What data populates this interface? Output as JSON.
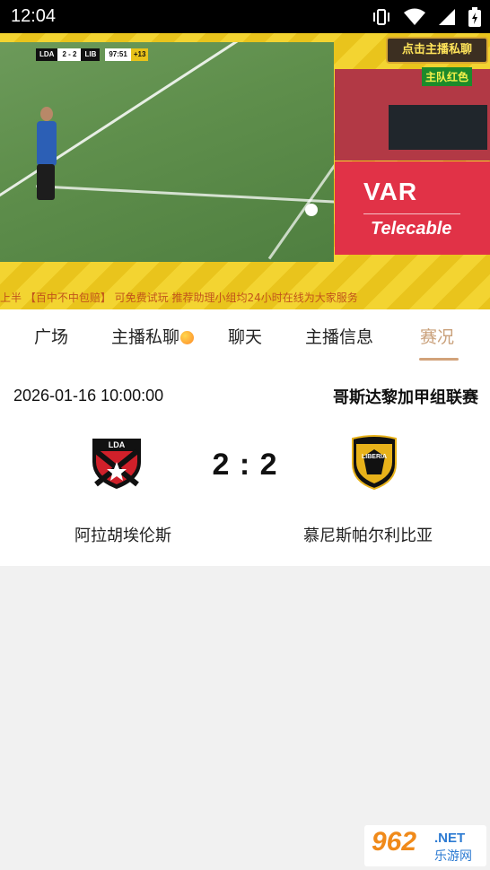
{
  "status_bar": {
    "time": "12:04",
    "icons": [
      "vibrate-icon",
      "wifi-icon",
      "signal-icon",
      "battery-icon"
    ]
  },
  "video": {
    "scorebug": {
      "home": "LDA",
      "score": "2 - 2",
      "away": "LIB",
      "clock": "97:51",
      "added": "+13"
    },
    "brand_badge": "点击主播私聊",
    "team_color_label": "主队红色",
    "var_title": "VAR",
    "var_sponsor": "Telecable",
    "ticker": "上半 【百中不中包赔】 可免费试玩 推荐助理小组均24小时在线为大家服务"
  },
  "tabs": [
    {
      "label": "广场",
      "active": false
    },
    {
      "label": "主播私聊",
      "active": false
    },
    {
      "label": "聊天",
      "active": false
    },
    {
      "label": "主播信息",
      "active": false
    },
    {
      "label": "赛况",
      "active": true
    }
  ],
  "match": {
    "datetime": "2026-01-16 10:00:00",
    "league": "哥斯达黎加甲组联赛",
    "score": "2 : 2",
    "home": {
      "name": "阿拉胡埃伦斯",
      "crest_text": "LDA"
    },
    "away": {
      "name": "慕尼斯帕尔利比亚",
      "crest_text": "LIBERIA"
    }
  },
  "watermark": {
    "num": "962",
    "net": ".NET",
    "cn": "乐游网"
  },
  "colors": {
    "accent": "#c9a07a",
    "tab_underline": "#d2a27a",
    "background": "#f1f1f1"
  }
}
